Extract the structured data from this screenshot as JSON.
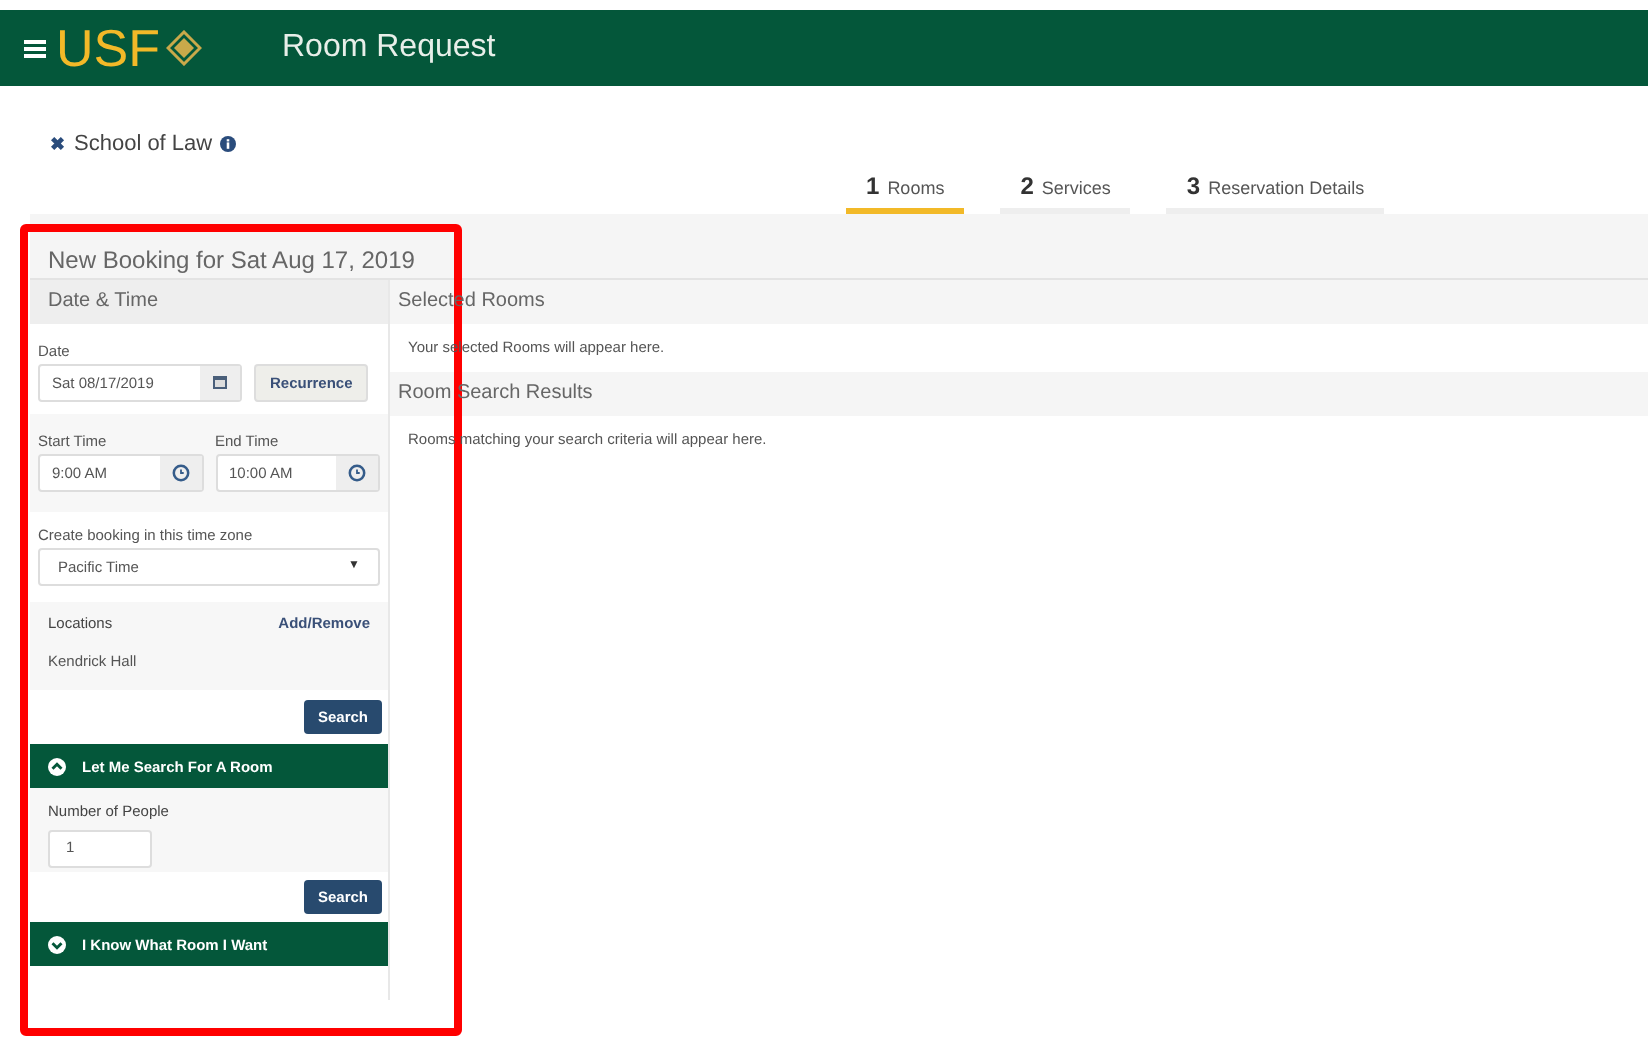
{
  "header": {
    "logo": "USF",
    "title": "Room Request"
  },
  "template": {
    "close_glyph": "✖",
    "name": "School of Law"
  },
  "steps": [
    {
      "number": "1",
      "label": "Rooms",
      "selected": true
    },
    {
      "number": "2",
      "label": "Services",
      "selected": false
    },
    {
      "number": "3",
      "label": "Reservation Details",
      "selected": false
    }
  ],
  "booking_title": "New Booking for Sat Aug 17, 2019",
  "date_time": {
    "heading": "Date & Time",
    "date_label": "Date",
    "date_value": "Sat 08/17/2019",
    "recurrence_button": "Recurrence",
    "start_label": "Start Time",
    "start_value": "9:00 AM",
    "end_label": "End Time",
    "end_value": "10:00 AM",
    "timezone_label": "Create booking in this time zone",
    "timezone_value": "Pacific Time",
    "timezone_caret": "▼",
    "locations_label": "Locations",
    "locations_link": "Add/Remove",
    "location": "Kendrick Hall",
    "search_button": "Search"
  },
  "search_section": {
    "heading": "Let Me Search For A Room",
    "expanded": true,
    "people_label": "Number of People",
    "people_value": "1",
    "search_button": "Search"
  },
  "known_section": {
    "heading": "I Know What Room I Want",
    "expanded": false
  },
  "selected_rooms": {
    "heading": "Selected Rooms",
    "message": "Your selected Rooms will appear here."
  },
  "search_results": {
    "heading": "Room Search Results",
    "message": "Rooms matching your search criteria will appear here."
  }
}
